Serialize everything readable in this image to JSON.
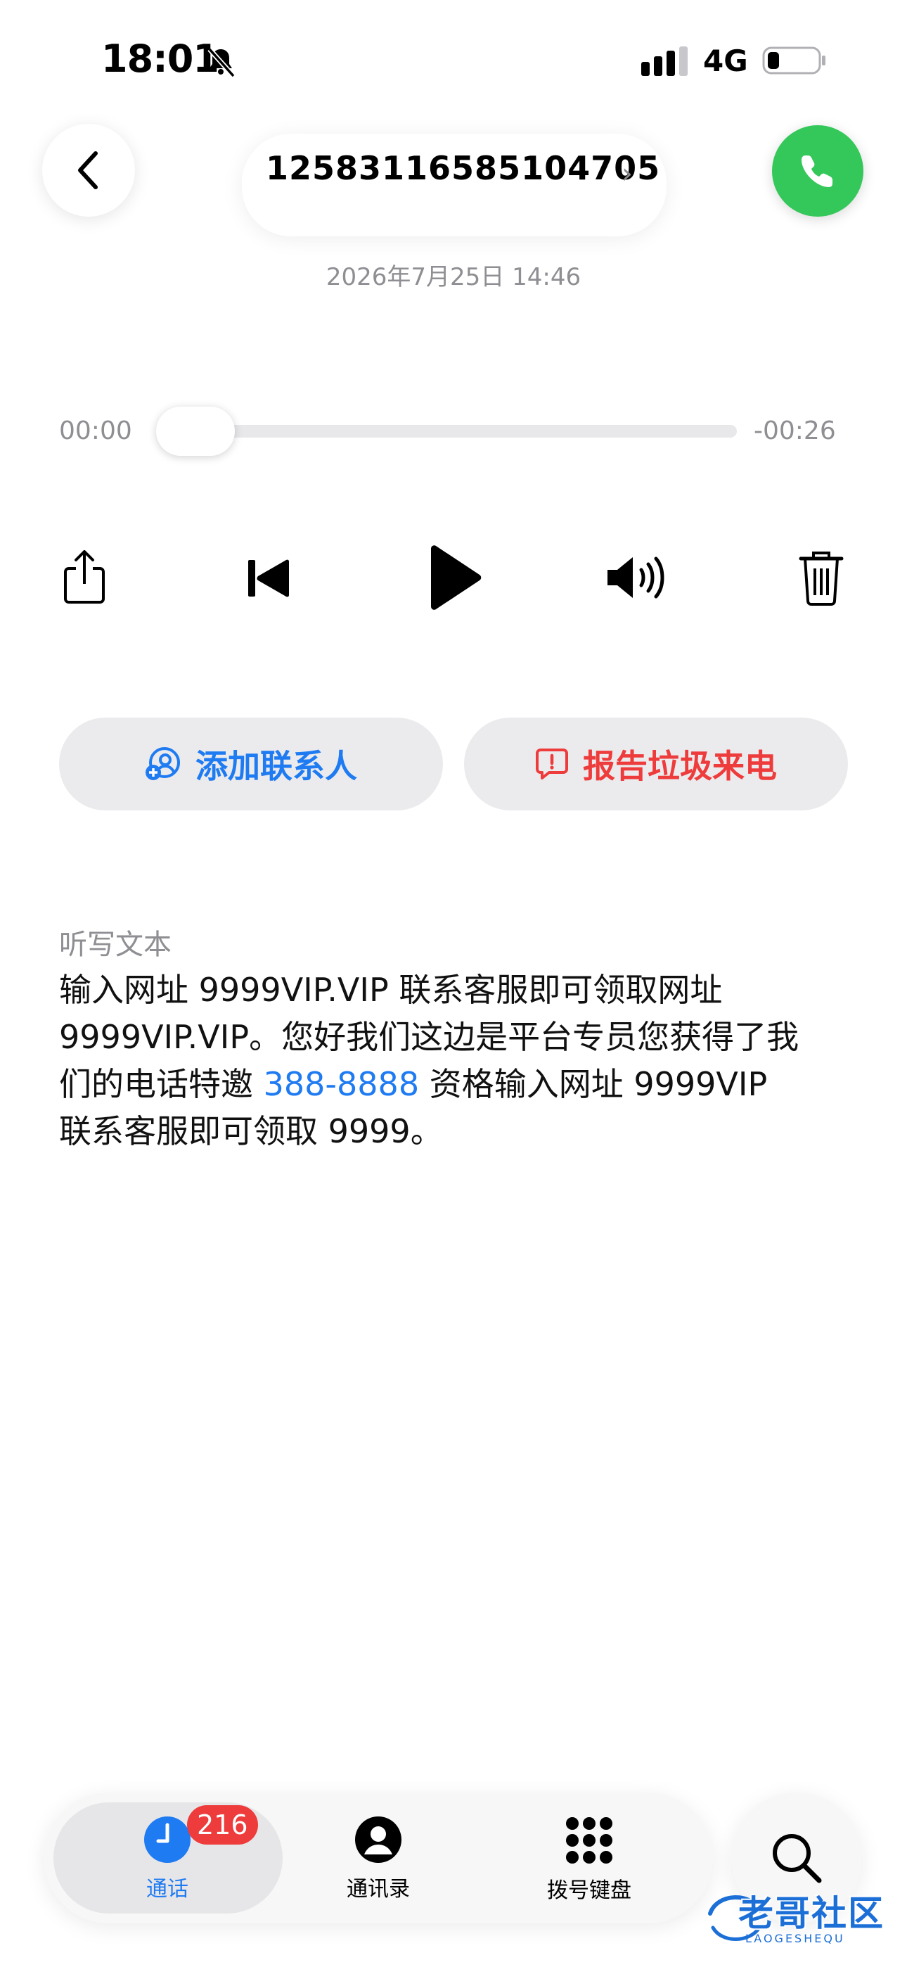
{
  "status_bar": {
    "time": "18:01",
    "network": "4G"
  },
  "header": {
    "phone_number": "12583116585104705",
    "chevron": "›",
    "datetime": "2026年7月25日 14:46"
  },
  "player": {
    "elapsed": "00:00",
    "remaining": "-00:26",
    "progress": 0
  },
  "actions": {
    "add_contact": "添加联系人",
    "report_spam": "报告垃圾来电"
  },
  "transcription": {
    "label": "听写文本",
    "text_before_link": "输入网址 9999VIP.VIP 联系客服即可领取网址 9999VIP.VIP。您好我们这边是平台专员您获得了我们的电话特邀 ",
    "link": "388-8888",
    "text_after_link": " 资格输入网址 9999VIP 联系客服即可领取  9999。"
  },
  "tab_bar": {
    "tabs": [
      {
        "label": "通话",
        "icon": "clock-icon",
        "active": true
      },
      {
        "label": "通讯录",
        "icon": "person-icon",
        "active": false
      },
      {
        "label": "拨号键盘",
        "icon": "keypad-icon",
        "active": false
      }
    ],
    "badge": "216"
  },
  "watermark": {
    "text": "老哥社区",
    "sub": "LAOGESHEQU"
  },
  "colors": {
    "accent": "#1f7bf2",
    "danger": "#ee3b3b",
    "call_green": "#34c759"
  }
}
